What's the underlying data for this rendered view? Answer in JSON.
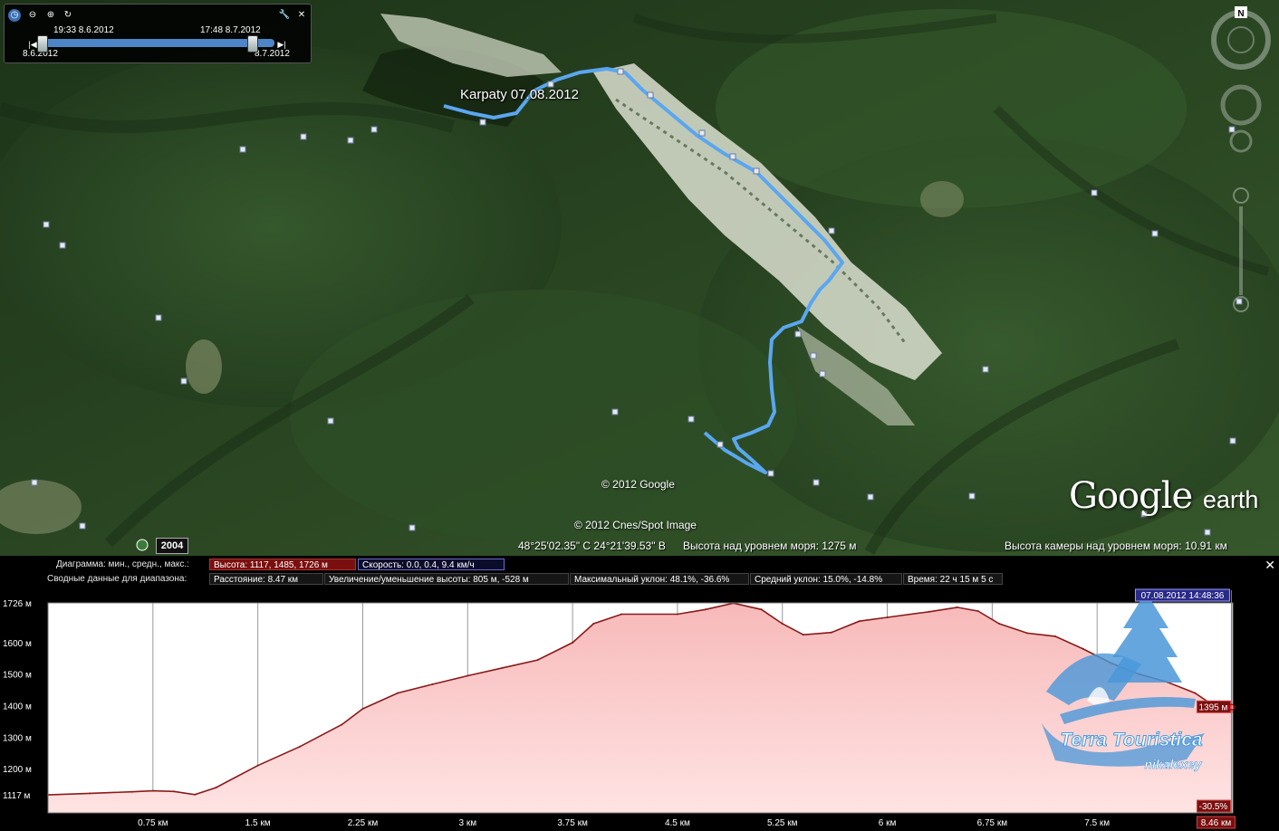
{
  "time_control": {
    "icons": [
      "clock-icon",
      "zoom-out-icon",
      "zoom-in-icon",
      "refresh-icon",
      "wrench-icon",
      "close-icon"
    ],
    "range_start_time": "19:33 8.6.2012",
    "range_end_time": "17:48 8.7.2012",
    "min_date": "8.6.2012",
    "max_date": "8.7.2012"
  },
  "map": {
    "track_label": "Karpaty 07.08.2012",
    "copyright_google": "© 2012 Google",
    "copyright_image": "© 2012 Cnes/Spot Image",
    "logo_main": "Google",
    "logo_sub": "earth",
    "north_label": "N",
    "historical_year": "2004",
    "track_color": "#5aa6f0"
  },
  "status_bar": {
    "coordinates": "48°25'02.35\" С  24°21'39.53\" В",
    "elevation": "Высота над уровнем моря:   1275 м",
    "camera_altitude": "Высота камеры над уровнем моря:   10.91 км"
  },
  "elevation_profile": {
    "row1_label": "Диаграмма: мин., средн., макс.:",
    "altitude_stat": "Высота: 1117, 1485, 1726 м",
    "speed_stat": "Скорость: 0.0, 0.4, 9.4 км/ч",
    "row2_label": "Сводные данные для диапазона:",
    "distance_stat": "Расстояние: 8.47 км",
    "gain_loss_stat": "Увеличение/уменьшение высоты: 805 м, -528 м",
    "max_slope_stat": "Максимальный уклон: 48.1%, -36.6%",
    "avg_slope_stat": "Средний уклон: 15.0%, -14.8%",
    "time_stat": "Время: 22 ч 15 м 5 с",
    "cursor_timestamp": "07.08.2012 14:48:36",
    "cursor_elevation": "1395 м",
    "cursor_slope": "-30.5%",
    "cursor_distance": "8.46 км",
    "fill_color": "#f7b9b9",
    "line_color": "#8b1a1a"
  },
  "chart_data": {
    "type": "area",
    "title": "",
    "xlabel": "",
    "ylabel": "",
    "x_unit": "км",
    "y_unit": "м",
    "xlim": [
      0,
      8.47
    ],
    "ylim": [
      1060,
      1726
    ],
    "y_ticks": [
      1117,
      1200,
      1300,
      1400,
      1500,
      1600,
      1726
    ],
    "y_tick_labels": [
      "1117 м",
      "1200 м",
      "1300 м",
      "1400 м",
      "1500 м",
      "1600 м",
      "1726 м"
    ],
    "x_ticks": [
      0.75,
      1.5,
      2.25,
      3,
      3.75,
      4.5,
      5.25,
      6,
      6.75,
      7.5
    ],
    "x_tick_labels": [
      "0.75 км",
      "1.5 км",
      "2.25 км",
      "3 км",
      "3.75 км",
      "4.5 км",
      "5.25 км",
      "6 км",
      "6.75 км",
      "7.5 км"
    ],
    "grid": true,
    "series": [
      {
        "x": [
          0,
          0.3,
          0.6,
          0.75,
          0.9,
          1.05,
          1.2,
          1.5,
          1.8,
          2.1,
          2.25,
          2.5,
          2.75,
          3.0,
          3.25,
          3.5,
          3.75,
          3.9,
          4.1,
          4.5,
          4.7,
          4.9,
          5.1,
          5.25,
          5.4,
          5.6,
          5.8,
          6.0,
          6.3,
          6.5,
          6.65,
          6.8,
          7.0,
          7.2,
          7.4,
          7.6,
          7.8,
          8.0,
          8.2,
          8.35,
          8.46
        ],
        "y": [
          1117,
          1122,
          1127,
          1130,
          1128,
          1118,
          1140,
          1210,
          1270,
          1340,
          1390,
          1440,
          1468,
          1495,
          1520,
          1545,
          1600,
          1660,
          1690,
          1690,
          1705,
          1725,
          1705,
          1660,
          1625,
          1632,
          1668,
          1680,
          1698,
          1712,
          1700,
          1660,
          1630,
          1620,
          1580,
          1535,
          1500,
          1475,
          1440,
          1395,
          1380
        ]
      }
    ],
    "cursor": {
      "x": 8.46,
      "y": 1395,
      "timestamp": "07.08.2012 14:48:36",
      "slope": "-30.5%"
    }
  },
  "watermark": {
    "line1": "Terra Touristica",
    "line2": "nikalexey",
    "color": "#4a97d8"
  }
}
